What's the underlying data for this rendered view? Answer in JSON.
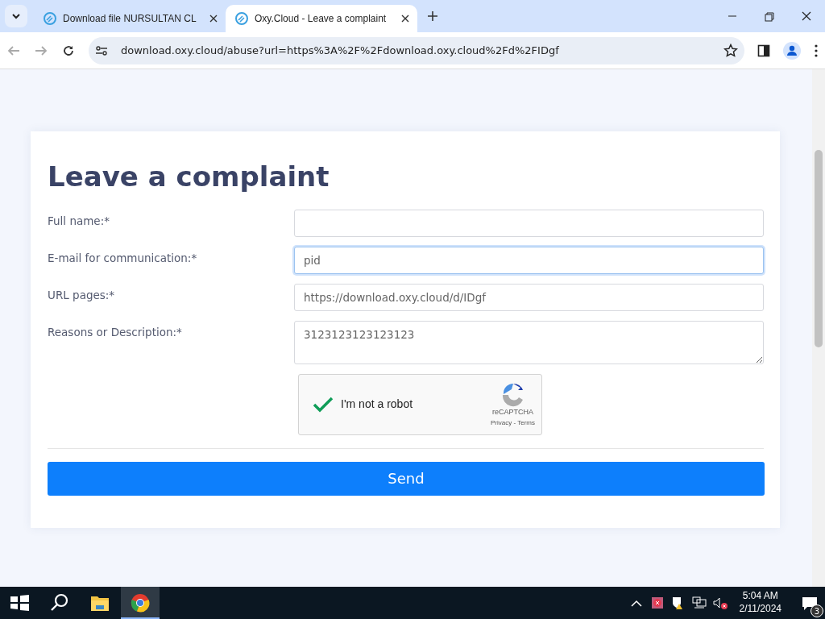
{
  "browser": {
    "tabs": [
      {
        "title": "Download file NURSULTAN CL",
        "selected": false
      },
      {
        "title": "Oxy.Cloud - Leave a complaint",
        "selected": true
      }
    ],
    "address": "download.oxy.cloud/abuse?url=https%3A%2F%2Fdownload.oxy.cloud%2Fd%2FIDgf"
  },
  "form": {
    "title": "Leave a complaint",
    "fields": [
      {
        "label": "Full name:*",
        "kind": "input",
        "focused": false
      },
      {
        "label": "E-mail for communication:*",
        "kind": "input",
        "value": "pid",
        "focused": true
      },
      {
        "label": "URL pages:*",
        "kind": "input",
        "value": "https://download.oxy.cloud/d/IDgf",
        "focused": false
      },
      {
        "label": "Reasons or Description:*",
        "kind": "textarea",
        "value": "3123123123123123",
        "focused": false
      }
    ],
    "captcha": {
      "checked": true,
      "label": "I'm not a robot",
      "brand": "reCAPTCHA",
      "links": "Privacy - Terms"
    },
    "submit": "Send"
  },
  "taskbar": {
    "time": "5:04 AM",
    "date": "2/11/2024",
    "notifications": "3"
  }
}
